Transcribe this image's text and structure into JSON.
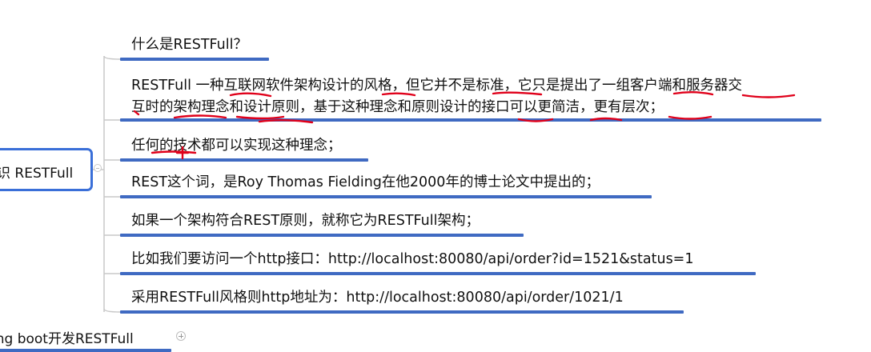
{
  "root": {
    "label": "识 RESTFull"
  },
  "topics": [
    {
      "lines": [
        "什么是RESTFull？"
      ]
    },
    {
      "lines": [
        "RESTFull 一种互联网软件架构设计的风格，但它并不是标准，它只是提出了一组客户端和服务器交",
        "互时的架构理念和设计原则，基于这种理念和原则设计的接口可以更简洁，更有层次；"
      ]
    },
    {
      "lines": [
        "任何的技术都可以实现这种理念；"
      ]
    },
    {
      "lines": [
        "REST这个词，是Roy Thomas Fielding在他2000年的博士论文中提出的；"
      ]
    },
    {
      "lines": [
        "如果一个架构符合REST原则，就称它为RESTFull架构；"
      ]
    },
    {
      "lines": [
        "比如我们要访问一个http接口：http://localhost:80080/api/order?id=1521&status=1"
      ]
    },
    {
      "lines": [
        "采用RESTFull风格则http地址为：http://localhost:80080/api/order/1021/1"
      ]
    }
  ],
  "sibling": {
    "label": "ing boot开发RESTFull"
  },
  "colors": {
    "root_border": "#3a6fd8",
    "underline": "#3f6ac2",
    "connector": "#c8c8c8",
    "annotation_red": "#e0001a"
  }
}
